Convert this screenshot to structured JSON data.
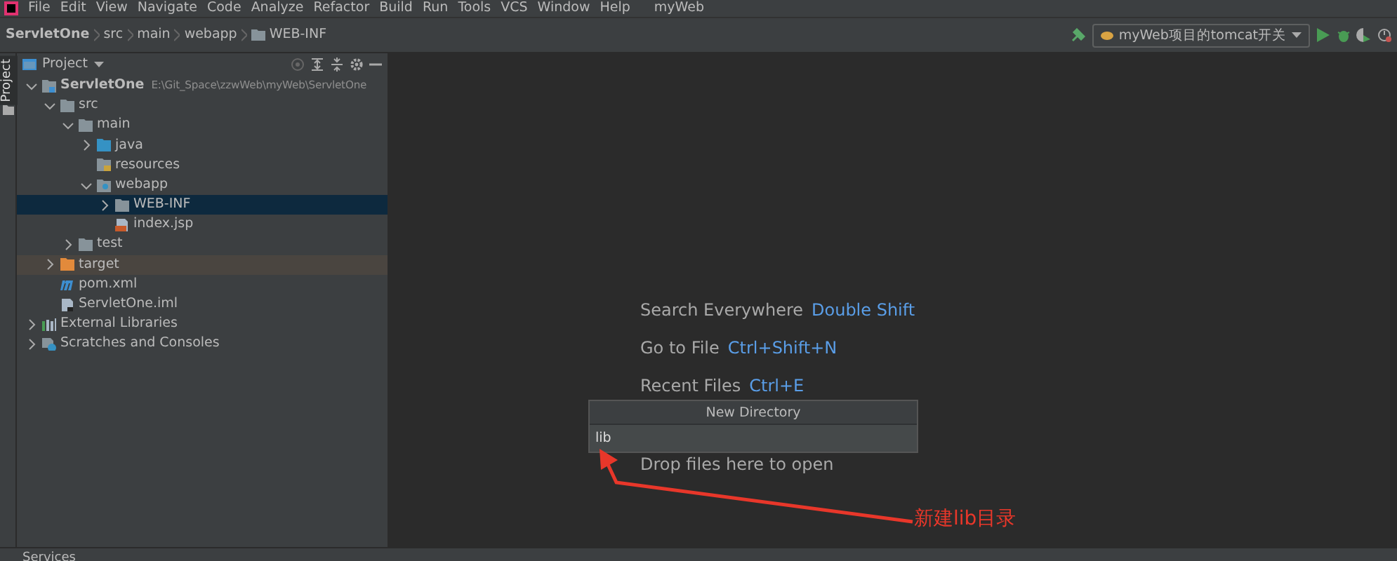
{
  "menu": {
    "items": [
      "File",
      "Edit",
      "View",
      "Navigate",
      "Code",
      "Analyze",
      "Refactor",
      "Build",
      "Run",
      "Tools",
      "VCS",
      "Window",
      "Help"
    ],
    "project_name": "myWeb"
  },
  "breadcrumb": [
    "ServletOne",
    "src",
    "main",
    "webapp",
    "WEB-INF"
  ],
  "run_config": "myWeb项目的tomcat开关",
  "side_tab": "Project",
  "project_panel": {
    "title": "Project"
  },
  "tree": [
    {
      "label": "ServletOne",
      "path": "E:\\Git_Space\\zzwWeb\\myWeb\\ServletOne",
      "kind": "module",
      "expanded": true,
      "selected": false,
      "children": [
        {
          "label": "src",
          "kind": "folder",
          "expanded": true,
          "selected": false,
          "children": [
            {
              "label": "main",
              "kind": "folder",
              "expanded": true,
              "selected": false,
              "children": [
                {
                  "label": "java",
                  "kind": "source",
                  "expanded": false,
                  "selected": false
                },
                {
                  "label": "resources",
                  "kind": "resources",
                  "selected": false
                },
                {
                  "label": "webapp",
                  "kind": "web",
                  "expanded": true,
                  "selected": false,
                  "children": [
                    {
                      "label": "WEB-INF",
                      "kind": "folder",
                      "expanded": false,
                      "selected": true
                    },
                    {
                      "label": "index.jsp",
                      "kind": "jsp",
                      "selected": false
                    }
                  ]
                }
              ]
            },
            {
              "label": "test",
              "kind": "folder",
              "expanded": false,
              "selected": false
            }
          ]
        },
        {
          "label": "target",
          "kind": "excluded",
          "expanded": false,
          "selected": false
        },
        {
          "label": "pom.xml",
          "kind": "maven",
          "selected": false
        },
        {
          "label": "ServletOne.iml",
          "kind": "iml",
          "selected": false
        }
      ]
    },
    {
      "label": "External Libraries",
      "kind": "libraries",
      "expanded": false,
      "selected": false
    },
    {
      "label": "Scratches and Consoles",
      "kind": "scratches",
      "expanded": false,
      "selected": false
    }
  ],
  "hints": [
    {
      "label": "Search Everywhere",
      "shortcut": "Double Shift"
    },
    {
      "label": "Go to File",
      "shortcut": "Ctrl+Shift+N"
    },
    {
      "label": "Recent Files",
      "shortcut": "Ctrl+E"
    }
  ],
  "new_directory": {
    "title": "New Directory",
    "value": "lib"
  },
  "drop_hint": "Drop files here to open",
  "annotation": "新建lib目录",
  "bottom_tab": "Services"
}
